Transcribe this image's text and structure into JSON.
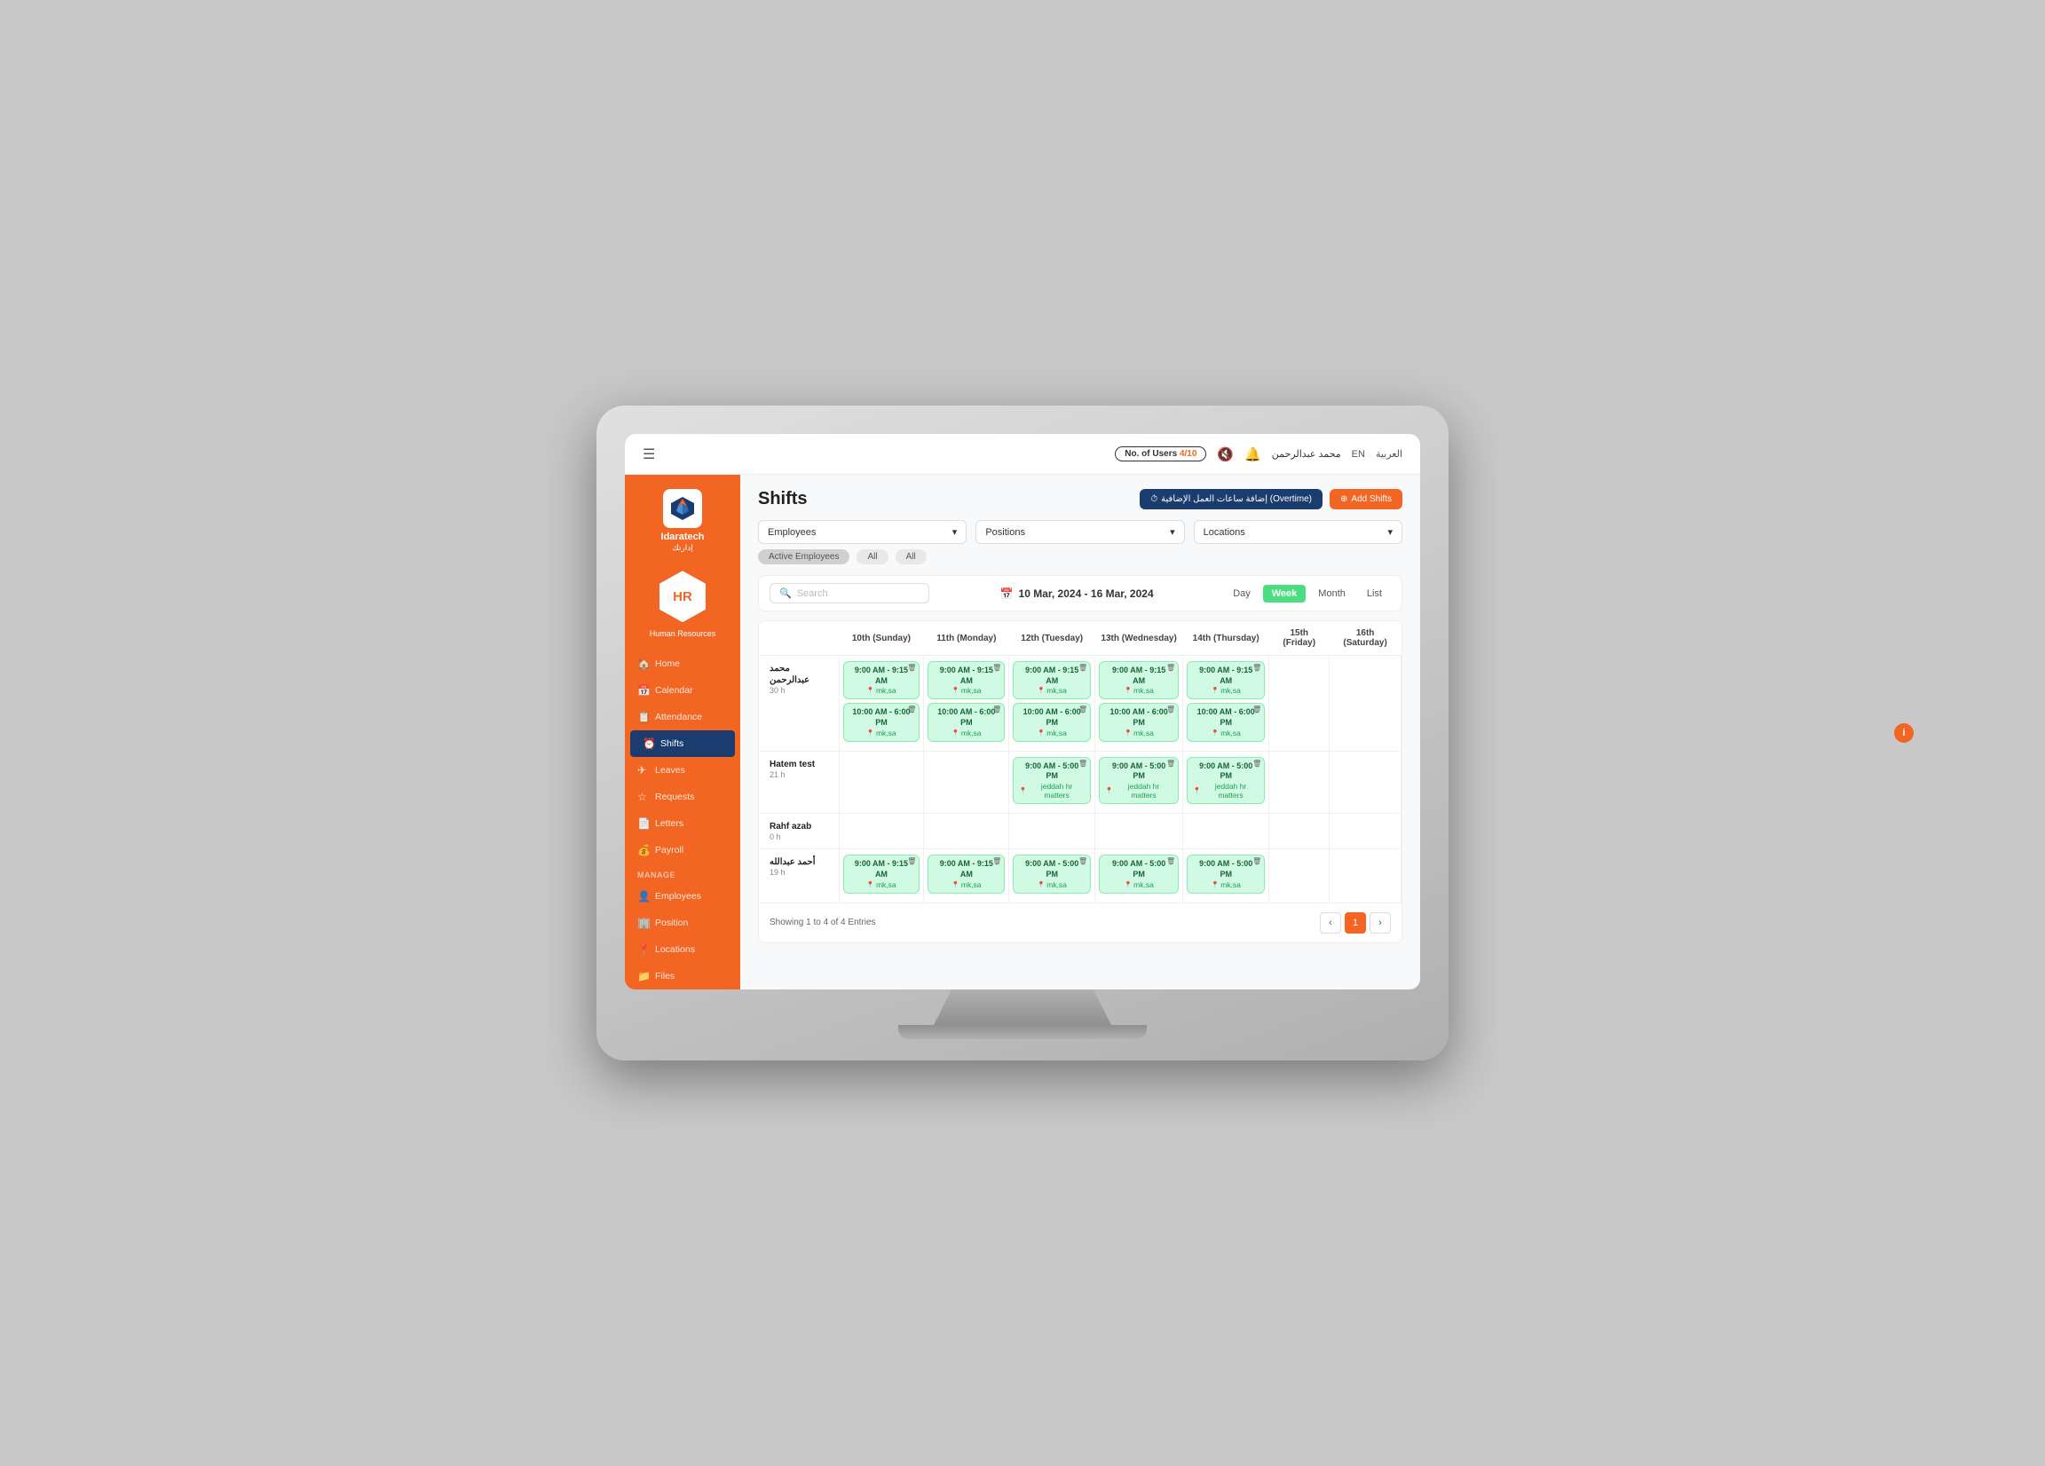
{
  "topbar": {
    "menu_icon": "☰",
    "users_label": "No. of Users",
    "users_count": "4/10",
    "mute_icon": "🔇",
    "notif_icon": "🔔",
    "user_name": "محمد عبدالرحمن",
    "lang_en": "EN",
    "lang_ar": "العربية"
  },
  "sidebar": {
    "logo_name": "Idaratech",
    "logo_arabic": "إدارتك",
    "hr_label": "HR",
    "dept_label": "Human Resources",
    "nav_items": [
      {
        "id": "home",
        "label": "Home",
        "icon": "🏠"
      },
      {
        "id": "calendar",
        "label": "Calendar",
        "icon": "📅"
      },
      {
        "id": "attendance",
        "label": "Attendance",
        "icon": "📋"
      },
      {
        "id": "shifts",
        "label": "Shifts",
        "icon": "⏰"
      },
      {
        "id": "leaves",
        "label": "Leaves",
        "icon": "✈"
      },
      {
        "id": "requests",
        "label": "Requests",
        "icon": "☆"
      },
      {
        "id": "letters",
        "label": "Letters",
        "icon": "📄"
      },
      {
        "id": "payroll",
        "label": "Payroll",
        "icon": "💰"
      }
    ],
    "manage_label": "MANAGE",
    "manage_items": [
      {
        "id": "employees",
        "label": "Employees",
        "icon": "👤"
      },
      {
        "id": "position",
        "label": "Position",
        "icon": "🏢"
      },
      {
        "id": "locations",
        "label": "Locations",
        "icon": "📍"
      },
      {
        "id": "files",
        "label": "Files",
        "icon": "📁"
      }
    ]
  },
  "page": {
    "title": "Shifts",
    "btn_overtime": "إضافة ساعات العمل الإضافية (Overtime)",
    "btn_add_shifts": "Add Shifts"
  },
  "filters": {
    "employees_placeholder": "Employees",
    "positions_placeholder": "Positions",
    "locations_placeholder": "Locations",
    "employees_tag": "Active Employees",
    "positions_tag": "All",
    "locations_tag": "All"
  },
  "calendar": {
    "search_placeholder": "Search",
    "date_range": "10 Mar, 2024 - 16 Mar, 2024",
    "date_icon": "📅",
    "views": [
      "Day",
      "Week",
      "Month",
      "List"
    ],
    "active_view": "Week",
    "columns": [
      {
        "label": "10th (Sunday)",
        "key": "sun"
      },
      {
        "label": "11th (Monday)",
        "key": "mon"
      },
      {
        "label": "12th (Tuesday)",
        "key": "tue"
      },
      {
        "label": "13th (Wednesday)",
        "key": "wed"
      },
      {
        "label": "14th (Thursday)",
        "key": "thu"
      },
      {
        "label": "15th (Friday)",
        "key": "fri"
      },
      {
        "label": "16th (Saturday)",
        "key": "sat"
      }
    ],
    "employees": [
      {
        "name": "محمد عبدالرحمن",
        "hours": "30 h",
        "shifts": {
          "sun": [
            {
              "time": "9:00 AM - 9:15 AM",
              "location": "mk,sa"
            },
            {
              "time": "10:00 AM - 6:00 PM",
              "location": "mk,sa"
            }
          ],
          "mon": [
            {
              "time": "9:00 AM - 9:15 AM",
              "location": "mk,sa"
            },
            {
              "time": "10:00 AM - 6:00 PM",
              "location": "mk,sa"
            }
          ],
          "tue": [
            {
              "time": "9:00 AM - 9:15 AM",
              "location": "mk,sa"
            },
            {
              "time": "10:00 AM - 6:00 PM",
              "location": "mk,sa"
            }
          ],
          "wed": [
            {
              "time": "9:00 AM - 9:15 AM",
              "location": "mk,sa"
            },
            {
              "time": "10:00 AM - 6:00 PM",
              "location": "mk,sa"
            }
          ],
          "thu": [
            {
              "time": "9:00 AM - 9:15 AM",
              "location": "mk,sa"
            },
            {
              "time": "10:00 AM - 6:00 PM",
              "location": "mk,sa"
            }
          ],
          "fri": [],
          "sat": []
        }
      },
      {
        "name": "Hatem test",
        "hours": "21 h",
        "shifts": {
          "sun": [],
          "mon": [],
          "tue": [
            {
              "time": "9:00 AM - 5:00 PM",
              "location": "jeddah hr matters"
            }
          ],
          "wed": [
            {
              "time": "9:00 AM - 5:00 PM",
              "location": "jeddah hr matters"
            }
          ],
          "thu": [
            {
              "time": "9:00 AM - 5:00 PM",
              "location": "jeddah hr matters"
            }
          ],
          "fri": [],
          "sat": []
        }
      },
      {
        "name": "Rahf azab",
        "hours": "0 h",
        "shifts": {
          "sun": [],
          "mon": [],
          "tue": [],
          "wed": [],
          "thu": [],
          "fri": [],
          "sat": []
        }
      },
      {
        "name": "أحمد عبدالله",
        "hours": "19 h",
        "shifts": {
          "sun": [
            {
              "time": "9:00 AM - 9:15 AM",
              "location": "mk,sa"
            }
          ],
          "mon": [
            {
              "time": "9:00 AM - 9:15 AM",
              "location": "mk,sa"
            }
          ],
          "tue": [
            {
              "time": "9:00 AM - 5:00 PM",
              "location": "mk,sa"
            }
          ],
          "wed": [
            {
              "time": "9:00 AM - 5:00 PM",
              "location": "mk,sa"
            }
          ],
          "thu": [
            {
              "time": "9:00 AM - 5:00 PM",
              "location": "mk,sa"
            }
          ],
          "fri": [],
          "sat": []
        }
      }
    ]
  },
  "pagination": {
    "showing": "Showing 1 to 4 of 4 Entries",
    "current_page": 1
  }
}
